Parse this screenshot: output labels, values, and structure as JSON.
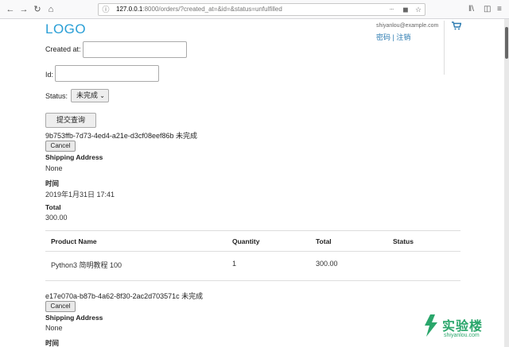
{
  "browser": {
    "url_host": "127.0.0.1",
    "url_rest": ":8000/orders/?created_at=&id=&status=unfulfilled",
    "more_label": "···"
  },
  "header": {
    "logo": "LOGO",
    "email": "shiyanlou@example.com",
    "password_link": "密码",
    "separator": "|",
    "logout_link": "注销"
  },
  "filter_form": {
    "created_at_label": "Created at:",
    "created_at_value": "",
    "id_label": "Id:",
    "id_value": "",
    "status_label": "Status:",
    "status_selected": "未完成",
    "submit_label": "提交查询"
  },
  "orders": [
    {
      "id_status": "9b753ffb-7d73-4ed4-a21e-d3cf08eef86b 未完成",
      "cancel_label": "Cancel",
      "shipping_heading": "Shipping Address",
      "shipping_value": "None",
      "time_heading": "时间",
      "time_value": "2019年1月31日 17:41",
      "total_heading": "Total",
      "total_value": "300.00",
      "table": {
        "headers": [
          "Product Name",
          "Quantity",
          "Total",
          "Status"
        ],
        "rows": [
          [
            "Python3 简明教程 100",
            "1",
            "300.00",
            ""
          ]
        ]
      }
    },
    {
      "id_status": "e17e070a-b87b-4a62-8f30-2ac2d703571c 未完成",
      "cancel_label": "Cancel",
      "shipping_heading": "Shipping Address",
      "shipping_value": "None",
      "time_heading": "时间"
    }
  ],
  "watermark": {
    "brand": "实验楼",
    "domain": "shiyanlou.com"
  },
  "colors": {
    "accent": "#2a9fd6",
    "link": "#2a7ab0",
    "watermark": "#2aa66b"
  }
}
